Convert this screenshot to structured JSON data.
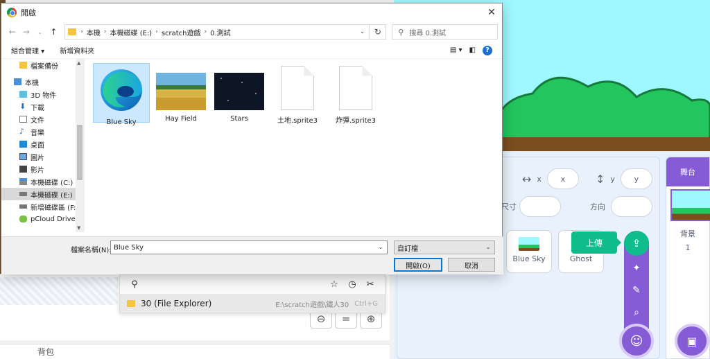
{
  "dialog": {
    "title": "開啟",
    "close": "✕",
    "address": {
      "crumbs": [
        "本機",
        "本機磁碟 (E:)",
        "scratch遊戲",
        "0.測試"
      ]
    },
    "search_placeholder": "搜尋 0.測試",
    "commands": {
      "organize": "組合管理 ▾",
      "new_folder": "新增資料夾"
    },
    "nav": {
      "items": [
        {
          "label": "檔案備份"
        },
        {
          "label": "本機"
        },
        {
          "label": "3D 物件"
        },
        {
          "label": "下載"
        },
        {
          "label": "文件"
        },
        {
          "label": "音樂"
        },
        {
          "label": "桌面"
        },
        {
          "label": "圖片"
        },
        {
          "label": "影片"
        },
        {
          "label": "本機磁碟 (C:)"
        },
        {
          "label": "本機磁碟 (E:)"
        },
        {
          "label": "新增磁碟區 (F:)"
        },
        {
          "label": "pCloud Drive (P"
        }
      ]
    },
    "files": [
      {
        "name": "Blue Sky"
      },
      {
        "name": "Hay Field"
      },
      {
        "name": "Stars"
      },
      {
        "name": "土地.sprite3"
      },
      {
        "name": "炸彈.sprite3"
      }
    ],
    "filename_label": "檔案名稱(N):",
    "filename_value": "Blue Sky",
    "filetype_value": "自訂檔",
    "open_button": "開啟(O)",
    "cancel_button": "取消"
  },
  "launcher": {
    "result_label": "30 (File Explorer)",
    "result_path": "E:\\scratch遊戲\\鐵人30",
    "result_shortcut": "Ctrl+G"
  },
  "scratch": {
    "backpack": "背包",
    "info": {
      "x_label": "x",
      "y_label": "y",
      "x_value": "x",
      "y_value": "y",
      "size_label": "尺寸",
      "direction_label": "方向"
    },
    "sprites": [
      {
        "name": "Blue Sky"
      },
      {
        "name": "Ghost"
      }
    ],
    "upload_tooltip": "上傳",
    "stage": {
      "title": "舞台",
      "backdrops_label": "背景",
      "backdrops_count": "1"
    },
    "zoom": {
      "out": "−",
      "reset": "=",
      "in": "+"
    }
  }
}
